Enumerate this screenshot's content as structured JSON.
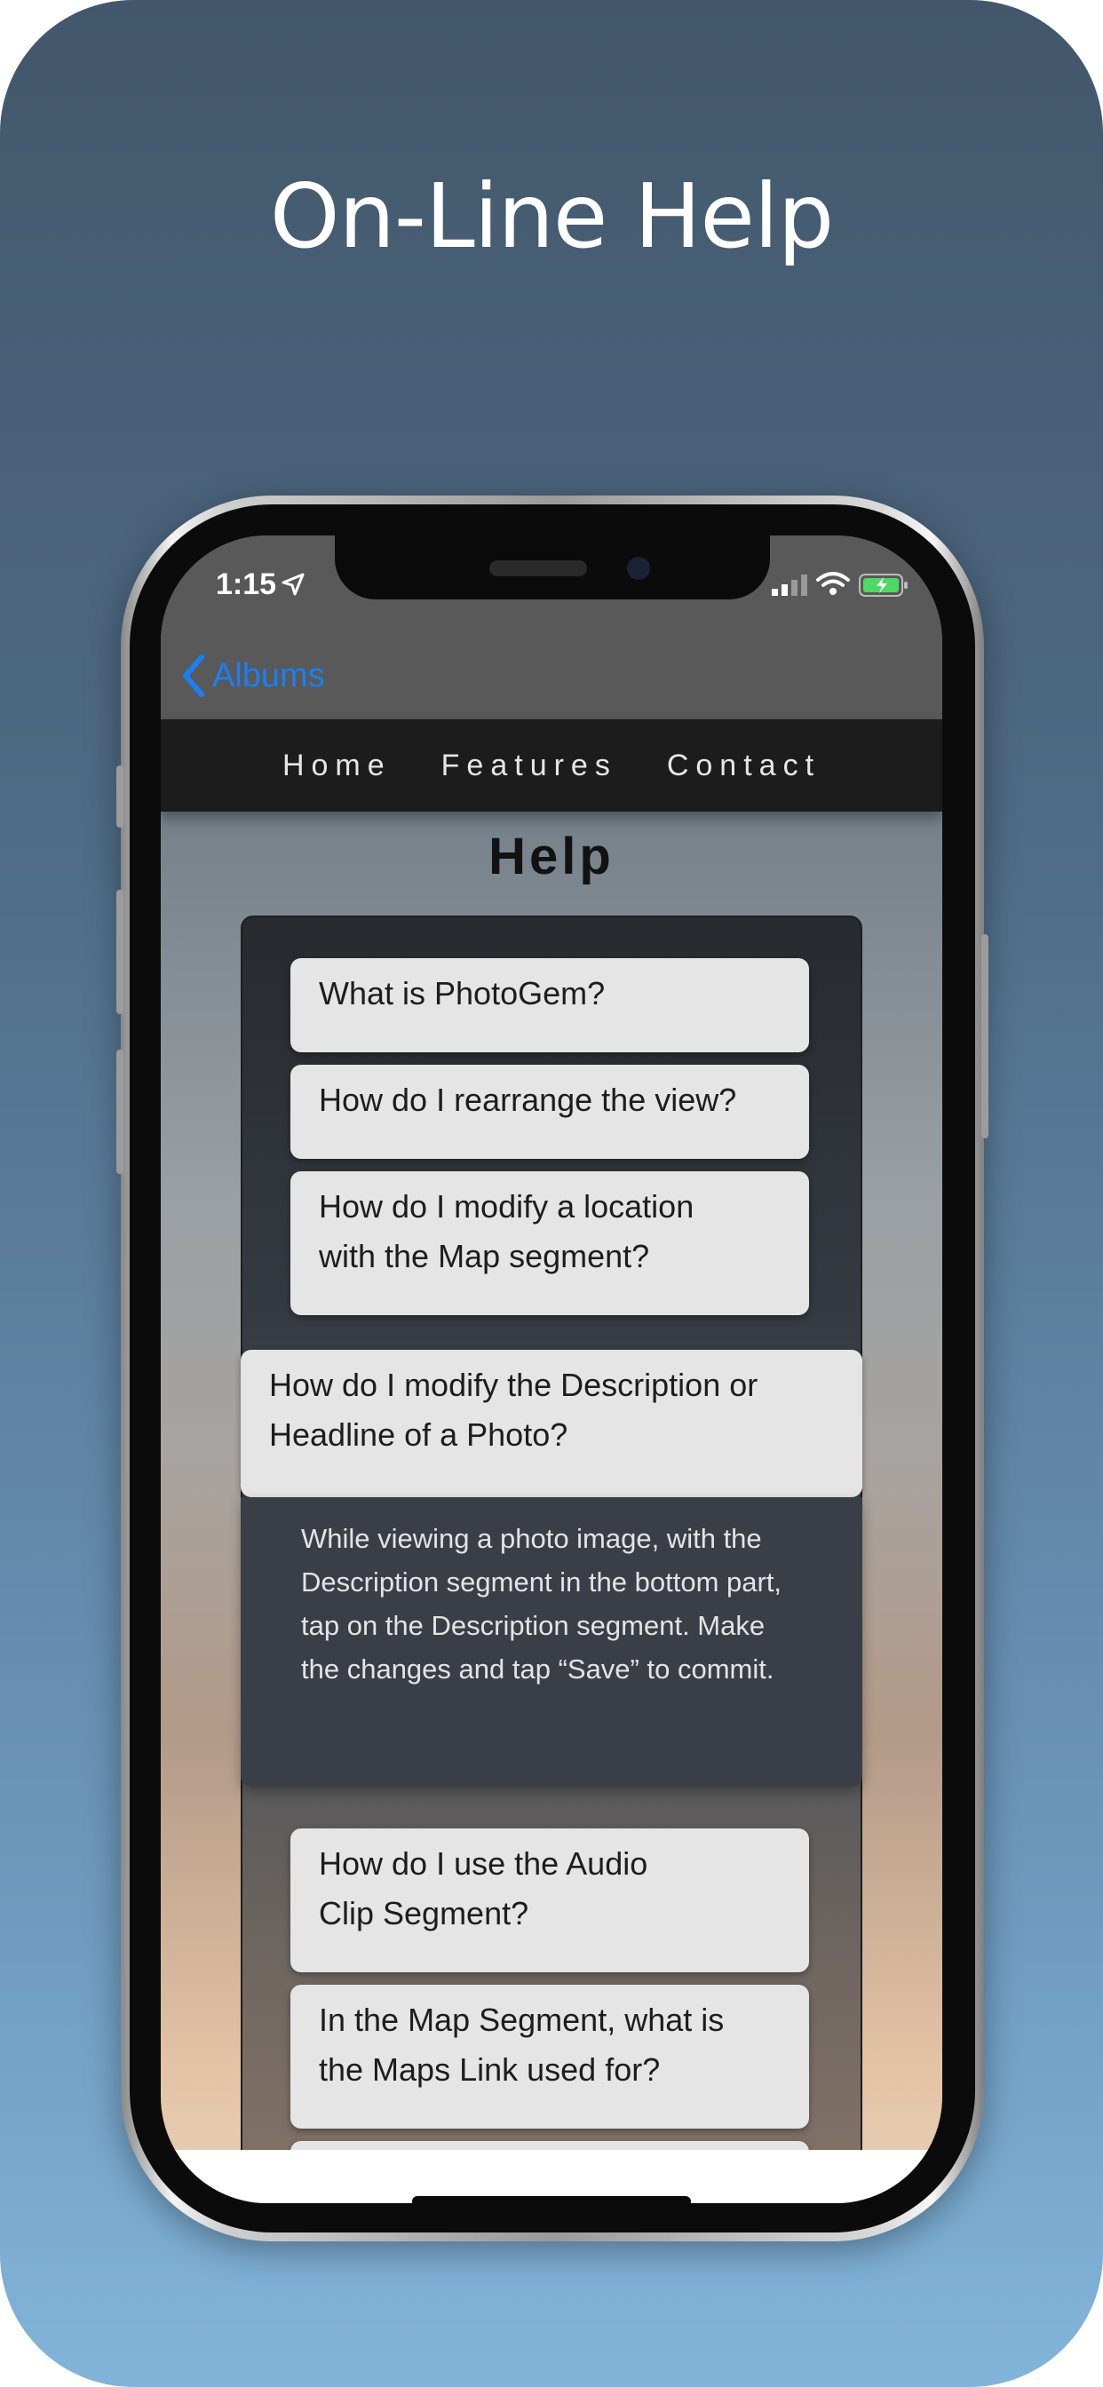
{
  "headline": "On-Line Help",
  "status_bar": {
    "time": "1:15",
    "icons": [
      "location-arrow-icon",
      "cellular-signal-icon",
      "wifi-icon",
      "battery-charging-icon"
    ]
  },
  "nav": {
    "back_label": "Albums",
    "menu": [
      "Home",
      "Features",
      "Contact"
    ]
  },
  "page": {
    "title": "Help",
    "questions": [
      "What is PhotoGem?",
      "How do I rearrange the view?",
      "How do I modify a location with the Map segment?",
      "How do I modify the Description or Headline of a Photo?",
      "How do I use the Audio Clip Segment?",
      "In the Map Segment, what is the Maps Link used for?"
    ],
    "expanded_answer": "While viewing a photo image, with the Description segment in the bottom part, tap on the Description segment. Make the changes and tap “Save” to commit."
  },
  "colors": {
    "accent": "#1a7ff5",
    "nav_background": "#1c1c1c",
    "question_background": "#e5e5e5",
    "answer_background": "#3a3f47"
  }
}
